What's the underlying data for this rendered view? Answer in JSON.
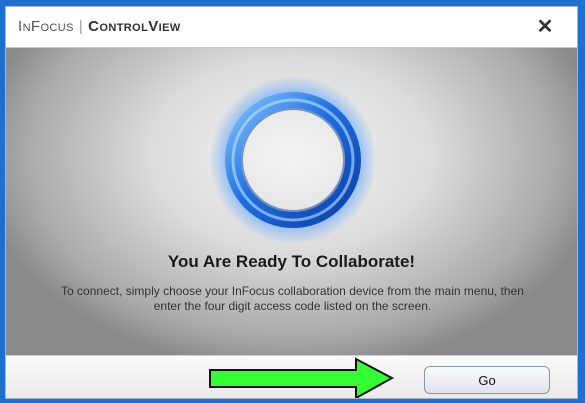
{
  "window": {
    "brand_left": "InFocus",
    "brand_right": "ControlView",
    "close_glyph": "✕"
  },
  "main": {
    "heading": "You Are Ready To Collaborate!",
    "message_line1": "To connect, simply choose your InFocus collaboration device from the main menu, then",
    "message_line2": "enter the four digit access code listed on the screen.",
    "ring_icon": "blue-glowing-ring-icon"
  },
  "footer": {
    "arrow_icon": "green-arrow-icon",
    "go_label": "Go"
  },
  "colors": {
    "ring_blue": "#2f7fe6",
    "arrow_green": "#33ff33",
    "frame_blue": "#1e6fd0"
  }
}
